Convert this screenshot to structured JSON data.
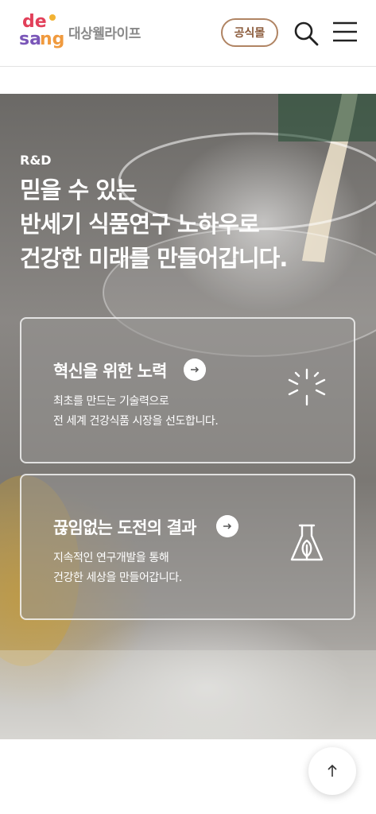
{
  "header": {
    "logo_text": "desang",
    "brand": "대상웰라이프",
    "mall_label": "공식몰",
    "search_icon": "search-icon",
    "menu_icon": "hamburger-menu-icon"
  },
  "hero": {
    "kicker": "R&D",
    "title_lines": [
      "믿을 수 있는",
      "반세기 식품연구 노하우로",
      "건강한 미래를 만들어갑니다."
    ]
  },
  "cards": [
    {
      "title": "혁신을 위한 노력",
      "desc_lines": [
        "최초를 만드는 기술력으로",
        "전 세계 건강식품 시장을 선도합니다."
      ],
      "icon": "spark-icon"
    },
    {
      "title": "끊임없는 도전의 결과",
      "desc_lines": [
        "지속적인 연구개발을 통해",
        "건강한 세상을 만들어갑니다."
      ],
      "icon": "flask-leaf-icon"
    }
  ],
  "scroll_top_icon": "arrow-up-icon",
  "colors": {
    "accent": "#b08463",
    "brand_text": "#8a8a8a"
  }
}
